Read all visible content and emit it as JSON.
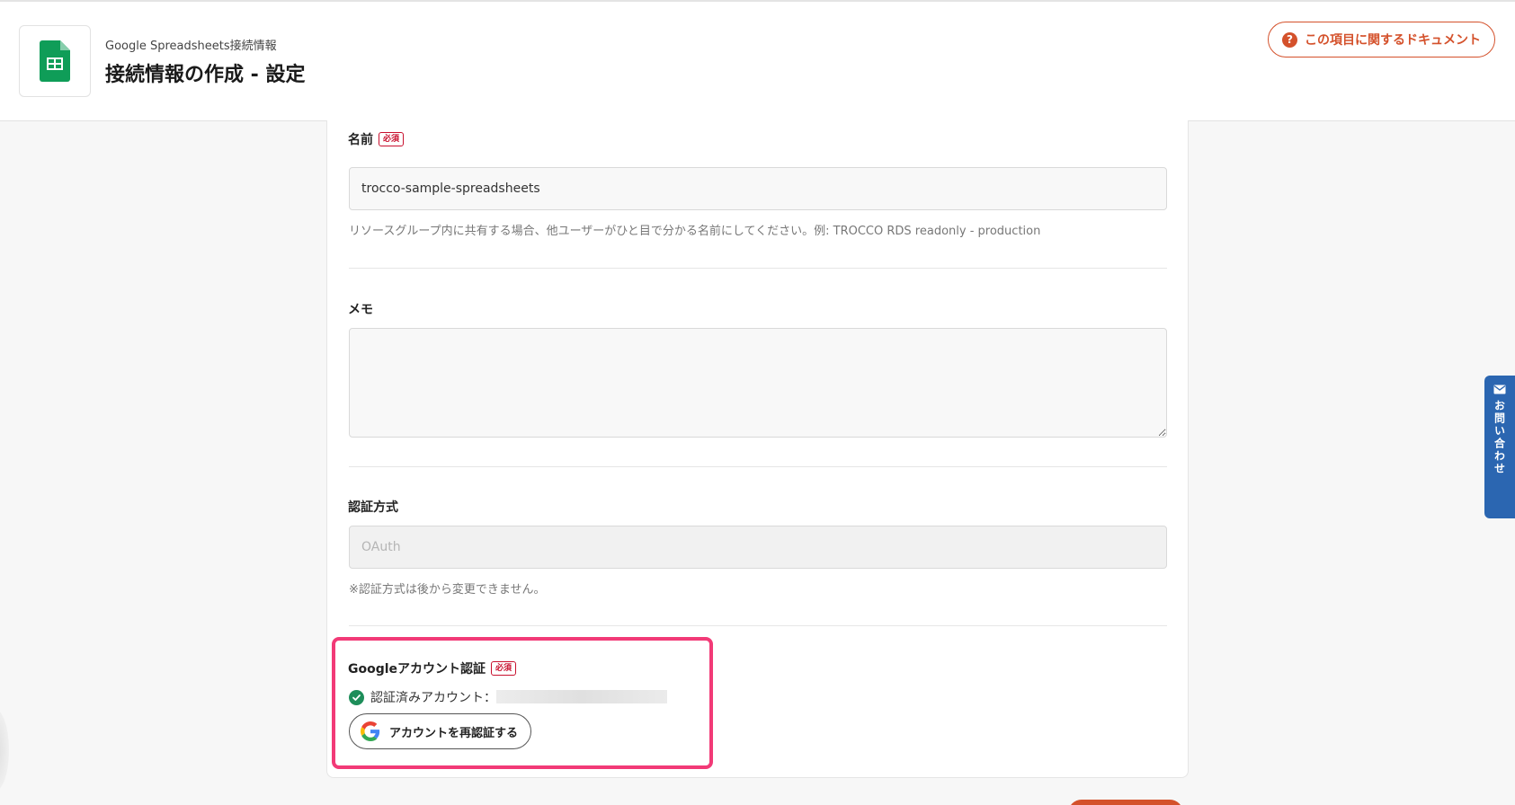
{
  "header": {
    "subtitle": "Google Spreadsheets接続情報",
    "title": "接続情報の作成 - 設定",
    "doc_button_label": "この項目に関するドキュメント"
  },
  "form": {
    "name": {
      "label": "名前",
      "required_badge": "必須",
      "value": "trocco-sample-spreadsheets",
      "help": "リソースグループ内に共有する場合、他ユーザーがひと目で分かる名前にしてください。例: TROCCO RDS readonly - production"
    },
    "memo": {
      "label": "メモ",
      "value": ""
    },
    "auth_method": {
      "label": "認証方式",
      "value": "OAuth",
      "help": "※認証方式は後から変更できません。"
    },
    "google_auth": {
      "label": "Googleアカウント認証",
      "required_badge": "必須",
      "status_text": "認証済みアカウント：",
      "reauth_button_label": "アカウントを再認証する"
    }
  },
  "side_tab": {
    "label": "お問い合わせ"
  },
  "colors": {
    "accent": "#d4512b",
    "highlight": "#f23a77",
    "contact_tab": "#2b66b1",
    "success": "#1e8e5a",
    "sheets_green": "#0f9d58"
  }
}
